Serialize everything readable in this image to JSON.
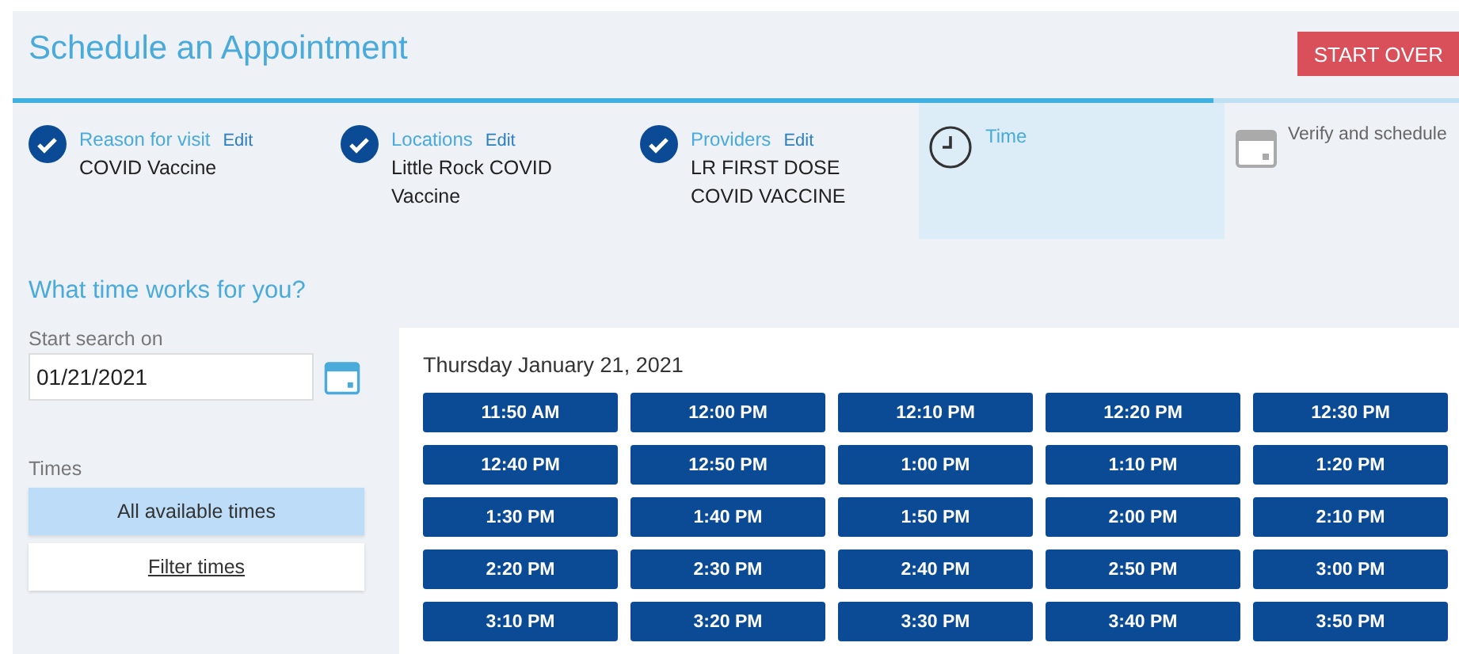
{
  "header": {
    "title": "Schedule an Appointment",
    "start_over": "START OVER"
  },
  "progress": {
    "level": 0.83
  },
  "steps": [
    {
      "kind": "done",
      "label": "Reason for visit",
      "edit": "Edit",
      "value": "COVID Vaccine"
    },
    {
      "kind": "done",
      "label": "Locations",
      "edit": "Edit",
      "value": "Little Rock COVID Vaccine"
    },
    {
      "kind": "done",
      "label": "Providers",
      "edit": "Edit",
      "value": "LR FIRST DOSE COVID VACCINE"
    },
    {
      "kind": "current",
      "label": "Time"
    },
    {
      "kind": "upcoming",
      "label": "Verify and schedule"
    }
  ],
  "question": "What time works for you?",
  "search": {
    "label": "Start search on",
    "value": "01/21/2021"
  },
  "times_filter": {
    "label": "Times",
    "options": [
      {
        "label": "All available times",
        "selected": true
      },
      {
        "label": "Filter times",
        "selected": false
      }
    ]
  },
  "day": {
    "title": "Thursday January 21, 2021",
    "slots": [
      "11:50 AM",
      "12:00 PM",
      "12:10 PM",
      "12:20 PM",
      "12:30 PM",
      "12:40 PM",
      "12:50 PM",
      "1:00 PM",
      "1:10 PM",
      "1:20 PM",
      "1:30 PM",
      "1:40 PM",
      "1:50 PM",
      "2:00 PM",
      "2:10 PM",
      "2:20 PM",
      "2:30 PM",
      "2:40 PM",
      "2:50 PM",
      "3:00 PM",
      "3:10 PM",
      "3:20 PM",
      "3:30 PM",
      "3:40 PM",
      "3:50 PM"
    ]
  }
}
